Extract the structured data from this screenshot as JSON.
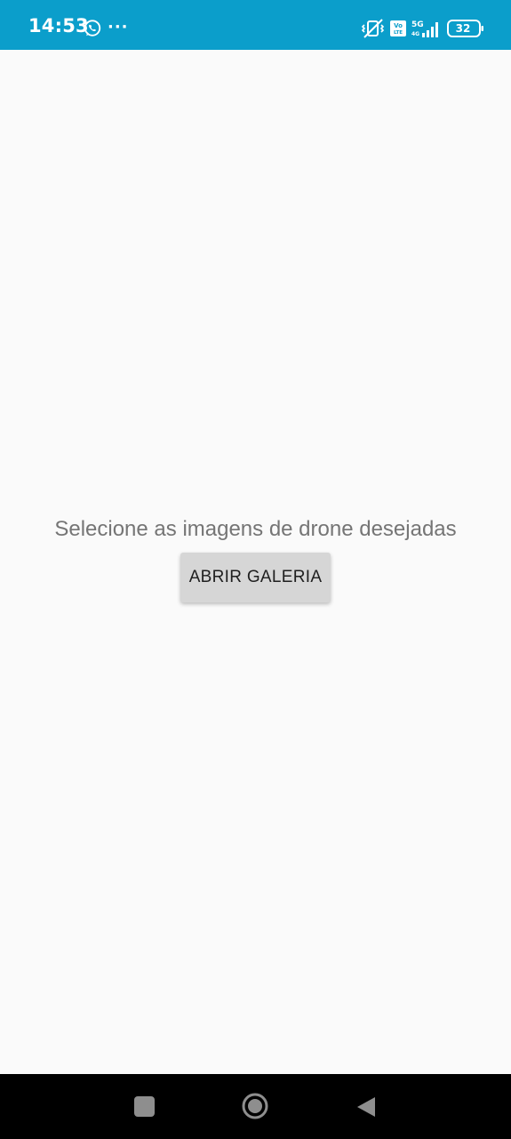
{
  "status_bar": {
    "time": "14:53",
    "notification_icons": [
      "whatsapp-icon",
      "more-notifications-icon"
    ],
    "more_notifications": "···",
    "system_icons": [
      "vibrate-mute-icon",
      "volte-icon",
      "5g-signal-icon",
      "battery-icon"
    ],
    "volte_top": "Vo",
    "volte_bottom": "LTE",
    "network": "5G",
    "network_sub": "4G",
    "battery_level": "32",
    "background_color": "#0b9ecb"
  },
  "main": {
    "prompt": "Selecione as imagens de drone desejadas",
    "open_gallery_label": "ABRIR GALERIA",
    "background_color": "#fafafa"
  },
  "nav_bar": {
    "buttons": [
      "recents-icon",
      "home-icon",
      "back-icon"
    ]
  }
}
